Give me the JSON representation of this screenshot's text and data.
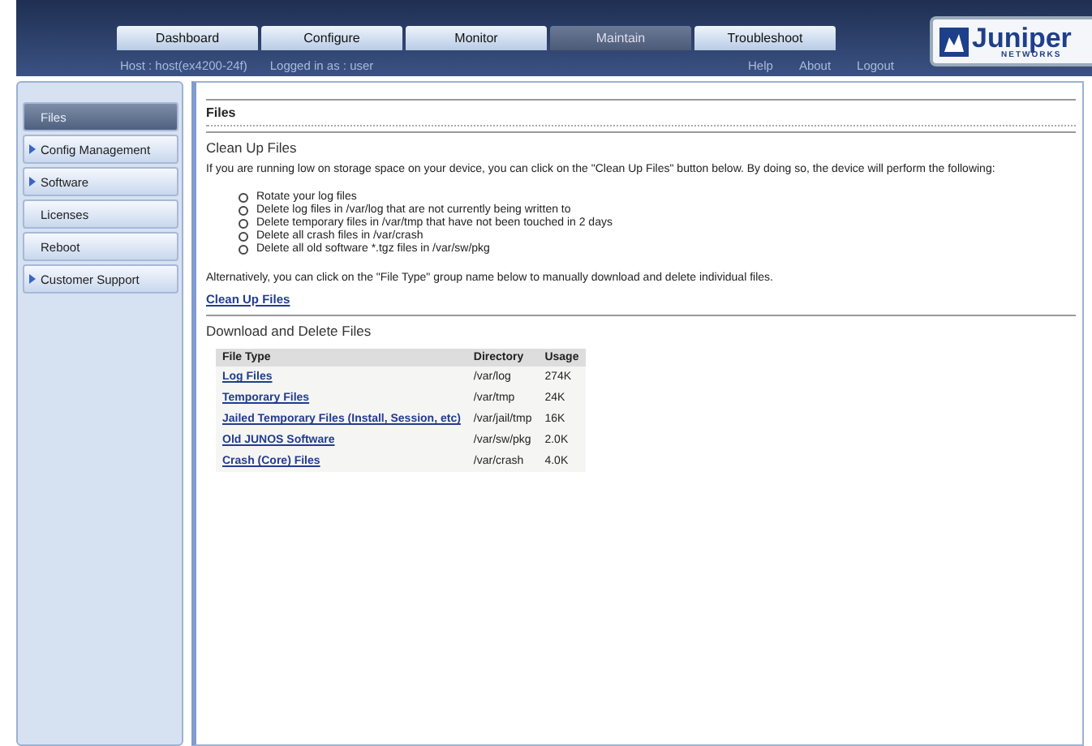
{
  "tabs": [
    {
      "label": "Dashboard",
      "selected": false
    },
    {
      "label": "Configure",
      "selected": false
    },
    {
      "label": "Monitor",
      "selected": false
    },
    {
      "label": "Maintain",
      "selected": true
    },
    {
      "label": "Troubleshoot",
      "selected": false
    }
  ],
  "logo": {
    "name": "Juniper",
    "subtitle": "NETWORKS"
  },
  "session": {
    "host": "Host : host(ex4200-24f)",
    "user": "Logged in as : user"
  },
  "header_links": [
    "Help",
    "About",
    "Logout"
  ],
  "sidebar": {
    "items": [
      {
        "label": "Files",
        "selected": true,
        "expandable": false
      },
      {
        "label": "Config Management",
        "selected": false,
        "expandable": true
      },
      {
        "label": "Software",
        "selected": false,
        "expandable": true
      },
      {
        "label": "Licenses",
        "selected": false,
        "expandable": false
      },
      {
        "label": "Reboot",
        "selected": false,
        "expandable": false
      },
      {
        "label": "Customer Support",
        "selected": false,
        "expandable": true
      }
    ]
  },
  "page_title": "Files",
  "cleanup": {
    "heading": "Clean Up Files",
    "intro": "If you are running low on storage space on your device, you can click on the \"Clean Up Files\" button below. By doing so, the device will perform the following:",
    "steps": [
      "Rotate your log files",
      "Delete log files in /var/log that are not currently being written to",
      "Delete temporary files in /var/tmp that have not been touched in 2 days",
      "Delete all crash files in /var/crash",
      "Delete all old software *.tgz files in /var/sw/pkg"
    ],
    "note": "Alternatively, you can click on the \"File Type\" group name below to manually download and delete individual files.",
    "link": "Clean Up Files"
  },
  "download": {
    "heading": "Download and Delete Files",
    "table": {
      "columns": [
        "File Type",
        "Directory",
        "Usage"
      ],
      "rows": [
        [
          "Log Files",
          "/var/log",
          "274K"
        ],
        [
          "Temporary Files",
          "/var/tmp",
          "24K"
        ],
        [
          "Jailed Temporary Files (Install, Session, etc)",
          "/var/jail/tmp",
          "16K"
        ],
        [
          "Old JUNOS Software",
          "/var/sw/pkg",
          "2.0K"
        ],
        [
          "Crash (Core) Files",
          "/var/crash",
          "4.0K"
        ]
      ]
    }
  }
}
